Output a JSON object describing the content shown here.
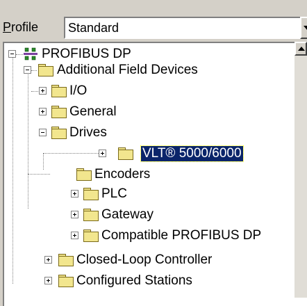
{
  "profile": {
    "label_accel": "P",
    "label_rest": "rofile",
    "value": "Standard"
  },
  "tree": {
    "root": "PROFIBUS DP",
    "nodes": [
      "Additional Field Devices",
      "I/O",
      "General",
      "Drives",
      "VLT® 5000/6000",
      "Encoders",
      "PLC",
      "Gateway",
      "Compatible PROFIBUS DP",
      "Closed-Loop Controller",
      "Configured Stations"
    ]
  }
}
